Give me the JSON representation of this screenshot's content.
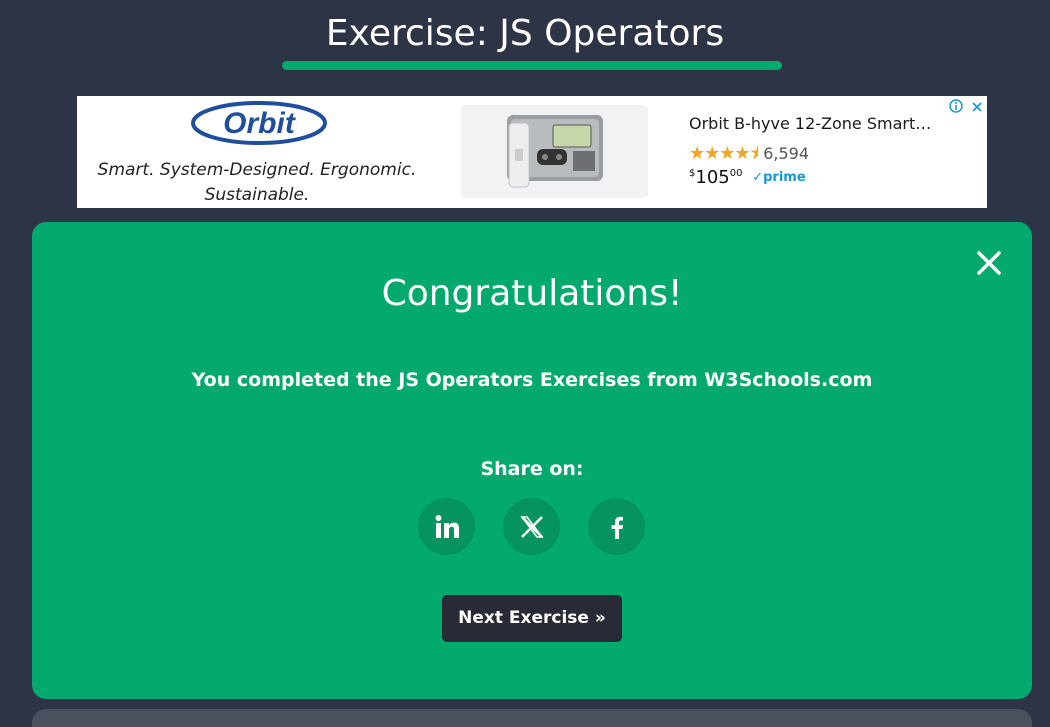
{
  "page": {
    "title": "Exercise: JS Operators"
  },
  "ad": {
    "brand": "Orbit",
    "tagline": "Smart. System-Designed. Ergonomic. Sustainable.",
    "product_name": "Orbit B-hyve 12-Zone Smart…",
    "rating_stars": "★★★★⯨",
    "rating_count": "6,594",
    "price_currency": "$",
    "price_whole": "105",
    "price_fraction": "00",
    "prime_label": "✓prime",
    "info_icon": "info-icon",
    "close_icon": "close-icon"
  },
  "modal": {
    "heading": "Congratulations!",
    "message": "You completed the JS Operators Exercises from W3Schools.com",
    "share_label": "Share on:",
    "share_buttons": [
      {
        "name": "linkedin",
        "icon": "linkedin-icon"
      },
      {
        "name": "x",
        "icon": "x-icon"
      },
      {
        "name": "facebook",
        "icon": "facebook-icon"
      }
    ],
    "next_label": "Next Exercise »"
  },
  "colors": {
    "background": "#2D3446",
    "accent": "#04AA6D",
    "button_dark": "#282A35"
  }
}
